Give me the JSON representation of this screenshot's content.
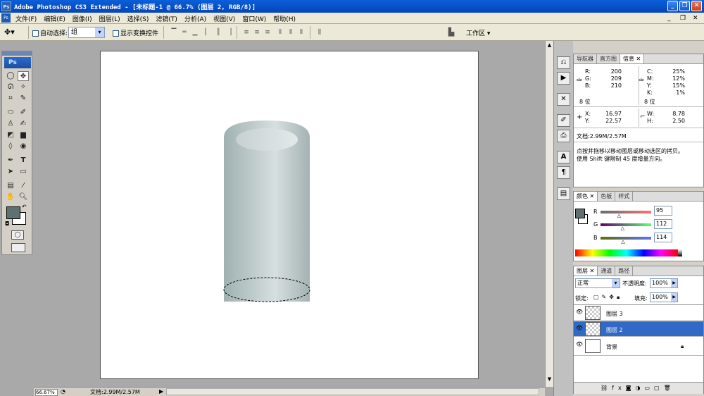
{
  "window": {
    "title": "Adobe Photoshop CS3 Extended - [未标题-1 @ 66.7% (图层 2, RGB/8)]"
  },
  "menu": [
    "文件(F)",
    "编辑(E)",
    "图像(I)",
    "图层(L)",
    "选择(S)",
    "滤镜(T)",
    "分析(A)",
    "视图(V)",
    "窗口(W)",
    "帮助(H)"
  ],
  "options": {
    "auto_select_label": "自动选择:",
    "auto_select_value": "组",
    "show_transform_label": "显示变换控件",
    "workspace_label": "工作区 ▾"
  },
  "toolbox": {
    "logo": "Ps"
  },
  "colors": {
    "foreground": "#5f7072",
    "background": "#ffffff",
    "cylinder_light": "#d3dcdc",
    "cylinder_dark": "#9aabac",
    "selection": "#3169c6"
  },
  "info_panel": {
    "tabs": [
      "导航器",
      "直方图",
      "信息"
    ],
    "rgb": {
      "r": "200",
      "g": "209",
      "b": "210"
    },
    "cmyk": {
      "c": "25%",
      "m": "12%",
      "y": "15%",
      "k": "1%"
    },
    "bits_left": "8 位",
    "bits_right": "8 位",
    "xy": {
      "x": "16.97",
      "y": "22.57"
    },
    "wh": {
      "w": "8.78",
      "h": "2.50"
    },
    "doc": "文档:2.99M/2.57M",
    "hint1": "点按并拖移以移动图层或移动选区的拷贝。",
    "hint2": "使用 Shift 键限制 45 度增量方向。"
  },
  "color_panel": {
    "tabs": [
      "颜色",
      "色板",
      "样式"
    ],
    "r": "95",
    "g": "112",
    "b": "114",
    "r_frac": 0.37,
    "g_frac": 0.44,
    "b_frac": 0.45
  },
  "layers_panel": {
    "tabs": [
      "图层",
      "通道",
      "路径"
    ],
    "blend": "正常",
    "opacity_label": "不透明度:",
    "opacity": "100%",
    "lock_label": "锁定:",
    "fill_label": "填充:",
    "fill": "100%",
    "layers": [
      {
        "name": "图层 3"
      },
      {
        "name": "图层 2"
      },
      {
        "name": "背景"
      }
    ]
  },
  "status": {
    "zoom": "66.67%",
    "doc": "文档:2.99M/2.57M"
  }
}
